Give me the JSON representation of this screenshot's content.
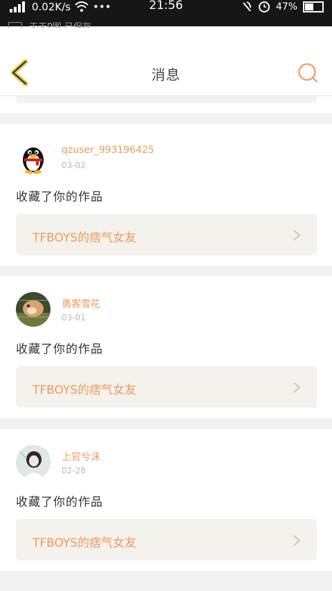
{
  "status_bar": {
    "network_speed": "0.02K/s",
    "time": "21:56",
    "battery": "47%"
  },
  "notification": {
    "text": "天天P图 已保存"
  },
  "header": {
    "title": "消息",
    "back_icon": "chevron-left-icon",
    "search_icon": "search-icon"
  },
  "colors": {
    "accent": "#f29a5b",
    "back_icon": "#e6c64a",
    "work_bg": "#f3f2ec"
  },
  "messages": [
    {
      "username": "qzuser_993196425",
      "date": "03-02",
      "action": "收藏了你的作品",
      "work_title": "TFBOYS的痞气女友",
      "avatar": "qq-penguin-avatar"
    },
    {
      "username": "勇客雪花",
      "date": "03-01",
      "action": "收藏了你的作品",
      "work_title": "TFBOYS的痞气女友",
      "avatar": "hamster-photo-avatar"
    },
    {
      "username": "上官兮沫",
      "date": "02-28",
      "action": "收藏了你的作品",
      "work_title": "TFBOYS的痞气女友",
      "avatar": "girl-photo-avatar"
    }
  ]
}
